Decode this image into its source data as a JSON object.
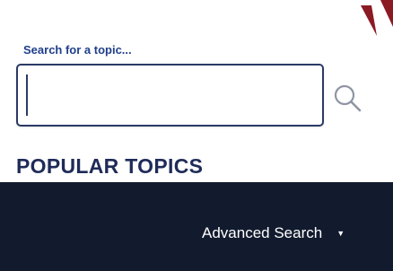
{
  "brand": {
    "logo_icon": "red-chevron-logo",
    "logo_color": "#8b1a24"
  },
  "search": {
    "label": "Search for a topic...",
    "value": "",
    "placeholder": "",
    "icon": "search-icon"
  },
  "popular": {
    "heading": "POPULAR TOPICS"
  },
  "footer": {
    "advanced_search_label": "Advanced Search",
    "caret_icon": "caret-down-icon",
    "caret_glyph": "▼"
  },
  "colors": {
    "label_blue": "#1f3f8a",
    "heading_navy": "#1f2b58",
    "footer_bg": "#121b2e",
    "input_border": "#2b3a66"
  }
}
